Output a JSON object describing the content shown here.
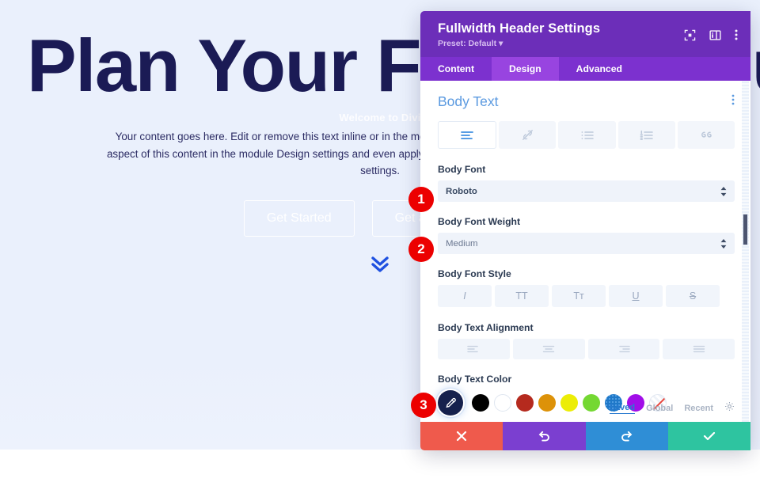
{
  "page": {
    "hero": {
      "title": "Plan Your Financial Future",
      "subtitle": "Welcome to Divi",
      "body": "Your content goes here. Edit or remove this text inline or in the module Content settings. You can also style every aspect of this content in the module Design settings and even apply custom CSS to this text in the module Advanced settings.",
      "button_primary": "Get Started",
      "button_secondary": "Get a Free Quote",
      "scroll_icon": "chevron-double-down-icon",
      "title_color": "#1b1b55",
      "background_color": "#eaf0fc",
      "chevron_color": "#1f51e0"
    }
  },
  "modal": {
    "title": "Fullwidth Header Settings",
    "preset": "Preset: Default",
    "header_icons": [
      {
        "name": "focus-mode-icon"
      },
      {
        "name": "panel-layout-icon"
      },
      {
        "name": "more-vertical-icon"
      }
    ],
    "tabs": [
      {
        "label": "Content",
        "active": false
      },
      {
        "label": "Design",
        "active": true
      },
      {
        "label": "Advanced",
        "active": false
      }
    ],
    "header_bg": "#6c2eb9",
    "tabs_bg": "#7c31cf",
    "tab_active_bg": "#9844e0"
  },
  "section": {
    "title": "Body Text",
    "kebab": "section-options-icon",
    "title_color": "#5b9ae0",
    "toolbar": [
      {
        "name": "paragraph-text-icon",
        "active": true
      },
      {
        "name": "link-icon",
        "active": false
      },
      {
        "name": "unordered-list-icon",
        "active": false
      },
      {
        "name": "ordered-list-icon",
        "active": false
      },
      {
        "name": "blockquote-icon",
        "active": false
      }
    ],
    "body_font": {
      "label": "Body Font",
      "value": "Roboto"
    },
    "body_font_weight": {
      "label": "Body Font Weight",
      "value": "Medium"
    },
    "body_font_style": {
      "label": "Body Font Style",
      "options": [
        {
          "glyph": "I",
          "name": "italic-button"
        },
        {
          "glyph": "TT",
          "name": "uppercase-button"
        },
        {
          "glyph": "Tᴛ",
          "name": "capitalize-button"
        },
        {
          "glyph": "U",
          "name": "underline-button"
        },
        {
          "glyph": "S",
          "name": "strikethrough-button"
        }
      ]
    },
    "body_text_alignment": {
      "label": "Body Text Alignment",
      "options": [
        {
          "name": "align-left-button"
        },
        {
          "name": "align-center-button"
        },
        {
          "name": "align-right-button"
        },
        {
          "name": "align-justify-button"
        }
      ]
    },
    "body_text_color": {
      "label": "Body Text Color",
      "picker_icon": "eyedropper-icon",
      "picker_bg": "#16214d",
      "swatches": [
        {
          "name": "swatch-black",
          "color": "#000000"
        },
        {
          "name": "swatch-white",
          "color": "#ffffff"
        },
        {
          "name": "swatch-red",
          "color": "#b52a1e"
        },
        {
          "name": "swatch-orange",
          "color": "#dd9209"
        },
        {
          "name": "swatch-yellow",
          "color": "#eced06"
        },
        {
          "name": "swatch-green",
          "color": "#74d832"
        },
        {
          "name": "swatch-blue",
          "color": "#1f78c8"
        },
        {
          "name": "swatch-purple",
          "color": "#a10ee8"
        },
        {
          "name": "swatch-none",
          "color": "transparent"
        }
      ],
      "more": "•••"
    },
    "palette_tabs": [
      {
        "label": "Saved",
        "active": true
      },
      {
        "label": "Global",
        "active": false
      },
      {
        "label": "Recent",
        "active": false
      }
    ],
    "palette_settings_icon": "gear-icon"
  },
  "actions": [
    {
      "name": "cancel-button",
      "icon": "x-icon",
      "color": "#ef5a4c"
    },
    {
      "name": "undo-button",
      "icon": "undo-icon",
      "color": "#7b3fd0"
    },
    {
      "name": "redo-button",
      "icon": "redo-icon",
      "color": "#2f8ed6"
    },
    {
      "name": "save-button",
      "icon": "checkmark-icon",
      "color": "#2ec4a0"
    }
  ],
  "badges": [
    {
      "number": "1"
    },
    {
      "number": "2"
    },
    {
      "number": "3"
    }
  ]
}
